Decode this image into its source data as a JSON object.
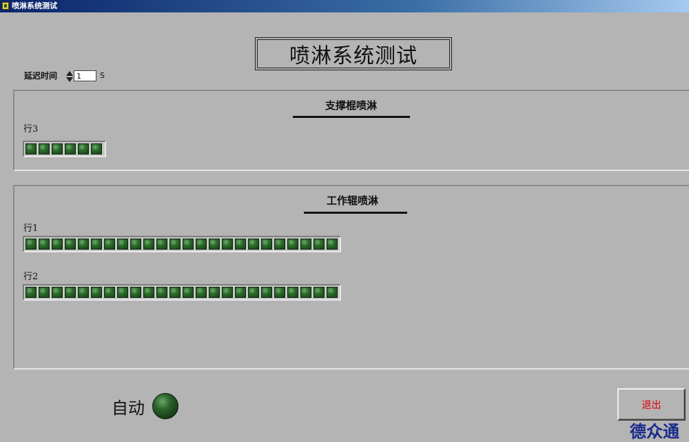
{
  "window": {
    "title": "喷淋系统测试"
  },
  "main_title": "喷淋系统测试",
  "delay": {
    "label": "延迟时间",
    "value": "1",
    "unit": "S"
  },
  "panels": [
    {
      "title": "支撑棍喷淋",
      "rows": [
        {
          "label": "行3",
          "led_count": 6
        }
      ]
    },
    {
      "title": "工作辊喷淋",
      "rows": [
        {
          "label": "行1",
          "led_count": 24
        },
        {
          "label": "行2",
          "led_count": 24
        }
      ]
    }
  ],
  "auto": {
    "label": "自动",
    "state": "off"
  },
  "exit_button": {
    "label": "退出"
  },
  "watermark": "德众通",
  "colors": {
    "background": "#b4b4b4",
    "led_on": "#2c6b2c",
    "exit_text": "#e00000",
    "watermark": "#1a2a8a"
  }
}
